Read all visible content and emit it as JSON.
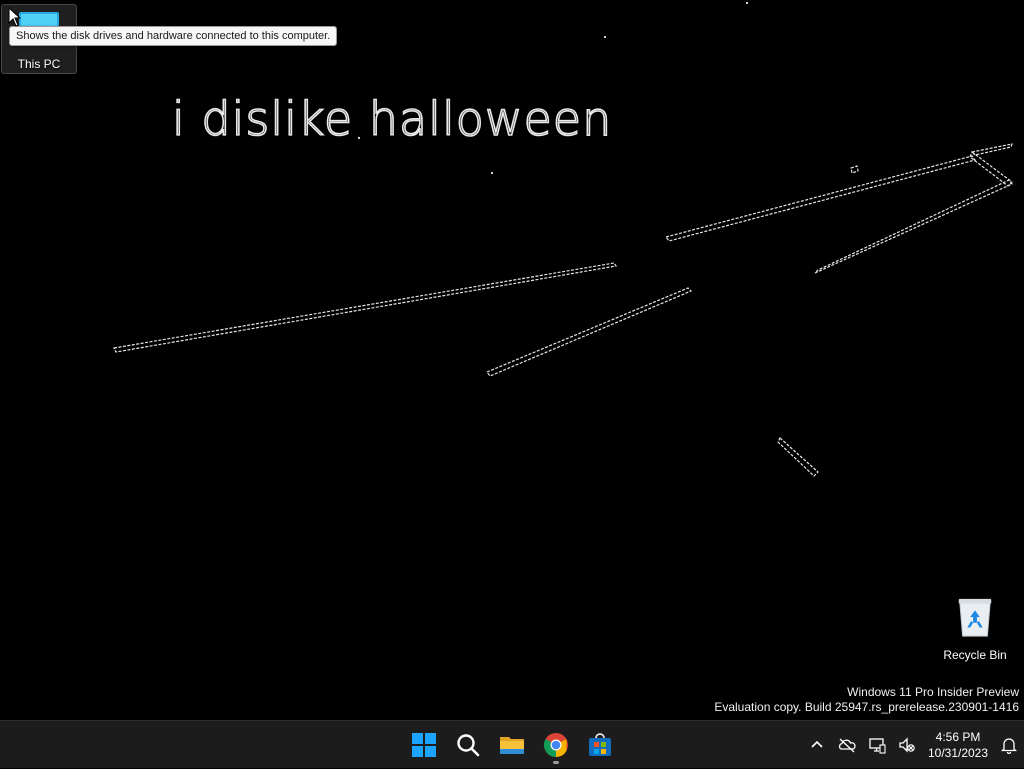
{
  "wallpaper": {
    "text": "i dislike halloween"
  },
  "desktop_icons": {
    "this_pc": {
      "label": "This PC",
      "icon": "monitor-icon"
    },
    "recycle_bin": {
      "label": "Recycle Bin",
      "icon": "recycle-bin-icon"
    }
  },
  "tooltip": {
    "text": "Shows the disk drives and hardware connected to this computer."
  },
  "watermark": {
    "line1": "Windows 11 Pro Insider Preview",
    "line2": "Evaluation copy. Build 25947.rs_prerelease.230901-1416"
  },
  "taskbar": {
    "apps": [
      {
        "name": "Start",
        "icon": "windows-start-icon"
      },
      {
        "name": "Search",
        "icon": "search-icon"
      },
      {
        "name": "File Explorer",
        "icon": "folder-icon"
      },
      {
        "name": "Google Chrome",
        "icon": "chrome-icon",
        "running": true
      },
      {
        "name": "Microsoft Store",
        "icon": "store-icon"
      }
    ],
    "tray": {
      "icons": [
        "chevron-up-icon",
        "onedrive-icon",
        "network-icon",
        "volume-muted-icon",
        "notification-bell-icon"
      ],
      "time": "4:56 PM",
      "date": "10/31/2023"
    }
  },
  "colors": {
    "taskbar_bg": "#1c1c1c",
    "start_blue": "#1aa3ff",
    "folder_yellow": "#f5c03a"
  }
}
